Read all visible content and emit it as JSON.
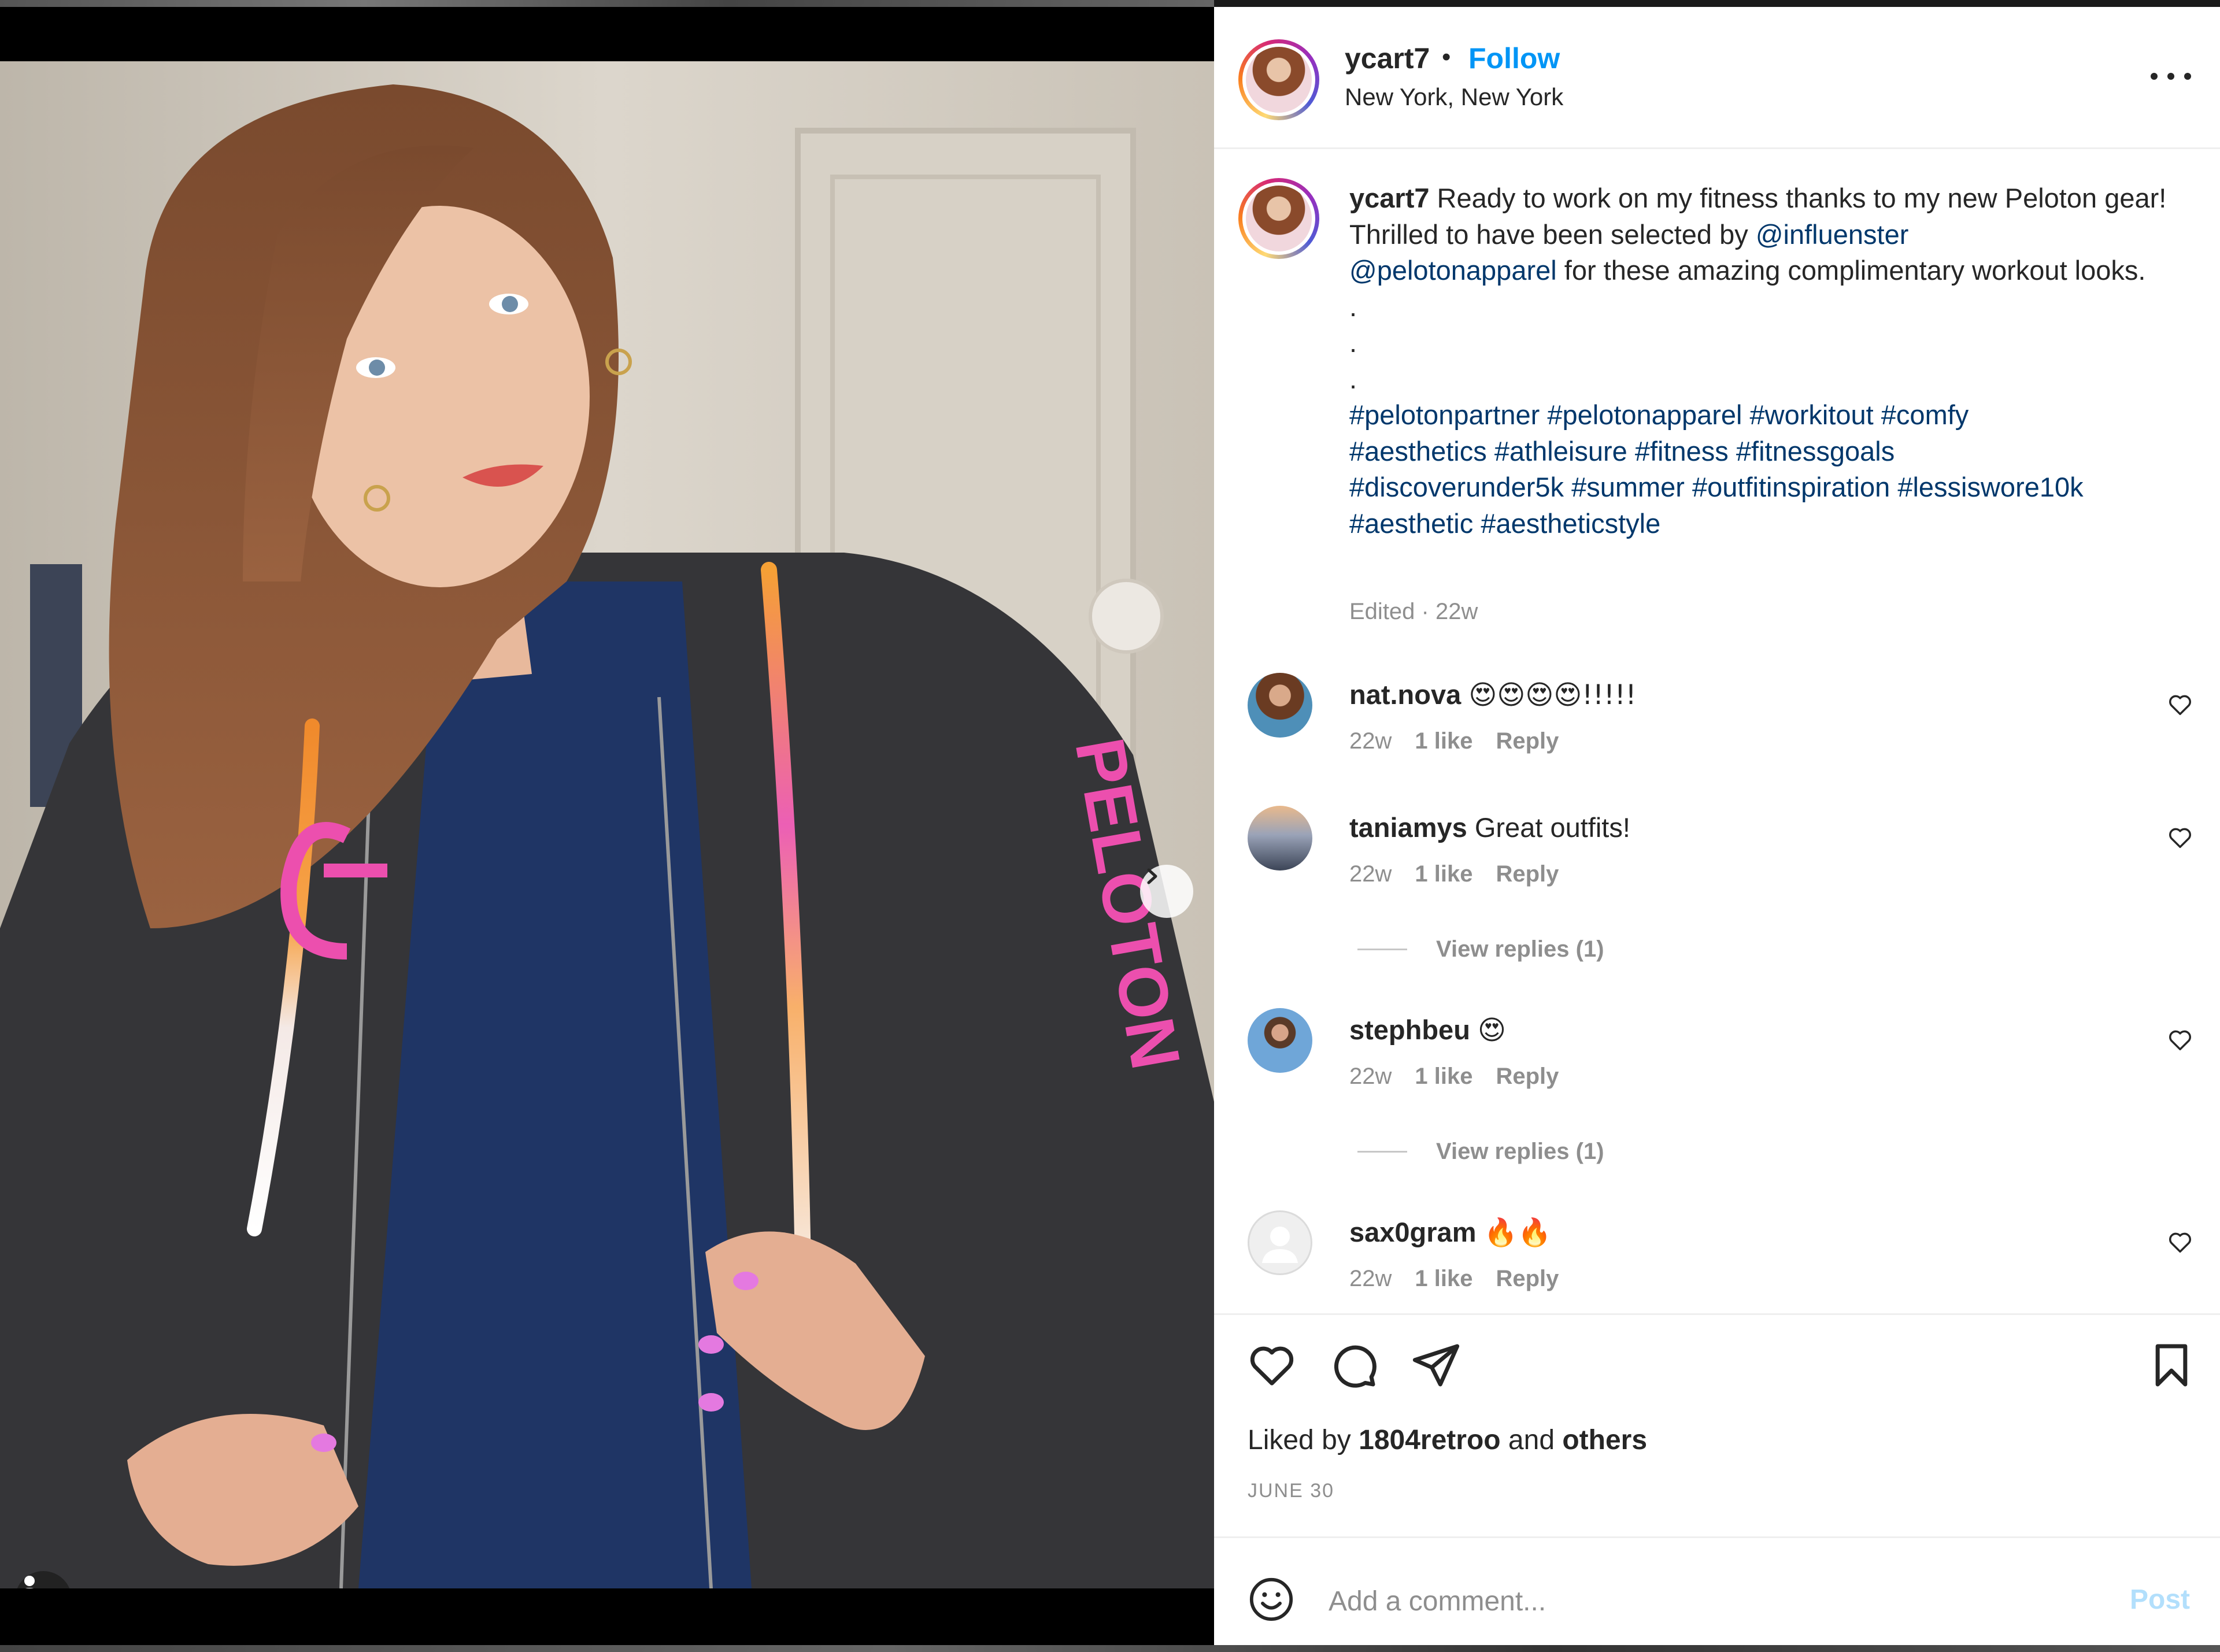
{
  "post": {
    "username": "ycart7",
    "follow_label": "Follow",
    "separator": "•",
    "location": "New York, New York",
    "more_label": "More options"
  },
  "caption": {
    "username": "ycart7",
    "text_1": " Ready to work on my fitness thanks to my new Peloton gear! Thrilled to have been selected by ",
    "mention_1": "@influenster",
    "mention_2": "@pelotonapparel",
    "text_2": " for these amazing complimentary workout looks.",
    "dots": ".",
    "hashtags": [
      "#pelotonpartner",
      "#pelotonapparel",
      "#workitout",
      "#comfy",
      "#aesthetics",
      "#athleisure",
      "#fitness",
      "#fitnessgoals",
      "#discoverunder5k",
      "#summer",
      "#outfitinspiration",
      "#lessiswore10k",
      "#aesthetic",
      "#aestheticstyle"
    ],
    "meta": "Edited · 22w"
  },
  "comments": [
    {
      "username": "nat.nova",
      "text": "😍😍😍😍!!!!!",
      "age": "22w",
      "likes": "1 like",
      "reply": "Reply"
    },
    {
      "username": "taniamys",
      "text": "Great outfits!",
      "age": "22w",
      "likes": "1 like",
      "reply": "Reply",
      "view_replies": "View replies (1)"
    },
    {
      "username": "stephbeu",
      "text": "😍",
      "age": "22w",
      "likes": "1 like",
      "reply": "Reply",
      "view_replies": "View replies (1)"
    },
    {
      "username": "sax0gram",
      "text": "🔥🔥",
      "age": "22w",
      "likes": "1 like",
      "reply": "Reply"
    }
  ],
  "actions": {
    "liked_prefix": "Liked by ",
    "liked_user": "1804retroo",
    "liked_mid": " and ",
    "liked_others": "others",
    "date": "JUNE 30"
  },
  "composer": {
    "placeholder": "Add a comment...",
    "post_label": "Post"
  },
  "carousel": {
    "index": 1,
    "count": 2
  },
  "colors": {
    "link": "#0095f6",
    "mention": "#00376b",
    "muted": "#8e8e8e",
    "post_disabled": "#b2dffc"
  }
}
